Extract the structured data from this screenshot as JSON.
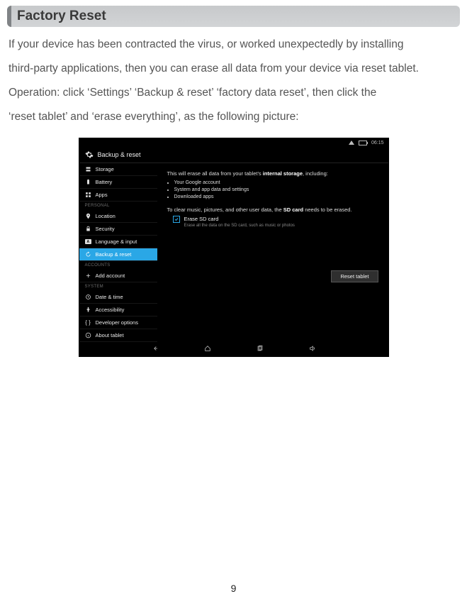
{
  "header": {
    "title": "Factory Reset"
  },
  "body": {
    "p1": "If your device has been contracted the virus, or worked unexpectedly by installing",
    "p2": "third-party applications, then you can erase all data from your device via reset tablet.",
    "p3": "Operation: click ‘Settings’  ‘Backup & reset’  ‘factory data reset’, then click the",
    "p4": "‘reset tablet’ and ‘erase everything’, as the following picture:"
  },
  "statusbar": {
    "time": "06:15"
  },
  "title_bar": {
    "label": "Backup & reset"
  },
  "sidebar": {
    "items": [
      {
        "icon": "storage",
        "label": "Storage"
      },
      {
        "icon": "battery",
        "label": "Battery"
      },
      {
        "icon": "apps",
        "label": "Apps"
      }
    ],
    "section_personal": "PERSONAL",
    "personal": [
      {
        "icon": "location",
        "label": "Location"
      },
      {
        "icon": "security",
        "label": "Security"
      },
      {
        "icon": "language",
        "label": "Language & input"
      },
      {
        "icon": "backup",
        "label": "Backup & reset",
        "selected": true
      }
    ],
    "section_accounts": "ACCOUNTS",
    "accounts": [
      {
        "icon": "add",
        "label": "Add account"
      }
    ],
    "section_system": "SYSTEM",
    "system": [
      {
        "icon": "date",
        "label": "Date & time"
      },
      {
        "icon": "access",
        "label": "Accessibility"
      },
      {
        "icon": "dev",
        "label": "Developer options"
      },
      {
        "icon": "about",
        "label": "About tablet"
      }
    ]
  },
  "content": {
    "intro_a": "This will erase all data from your tablet's ",
    "intro_b": "internal storage",
    "intro_c": ", including:",
    "list": [
      "Your Google account",
      "System and app data and settings",
      "Downloaded apps"
    ],
    "sd_a": "To clear music, pictures, and other user data, the ",
    "sd_b": "SD card",
    "sd_c": " needs to be erased.",
    "chk_label": "Erase SD card",
    "chk_sub": "Erase all the data on the SD card, such as music or photos",
    "reset_btn": "Reset tablet"
  },
  "page_number": "9"
}
